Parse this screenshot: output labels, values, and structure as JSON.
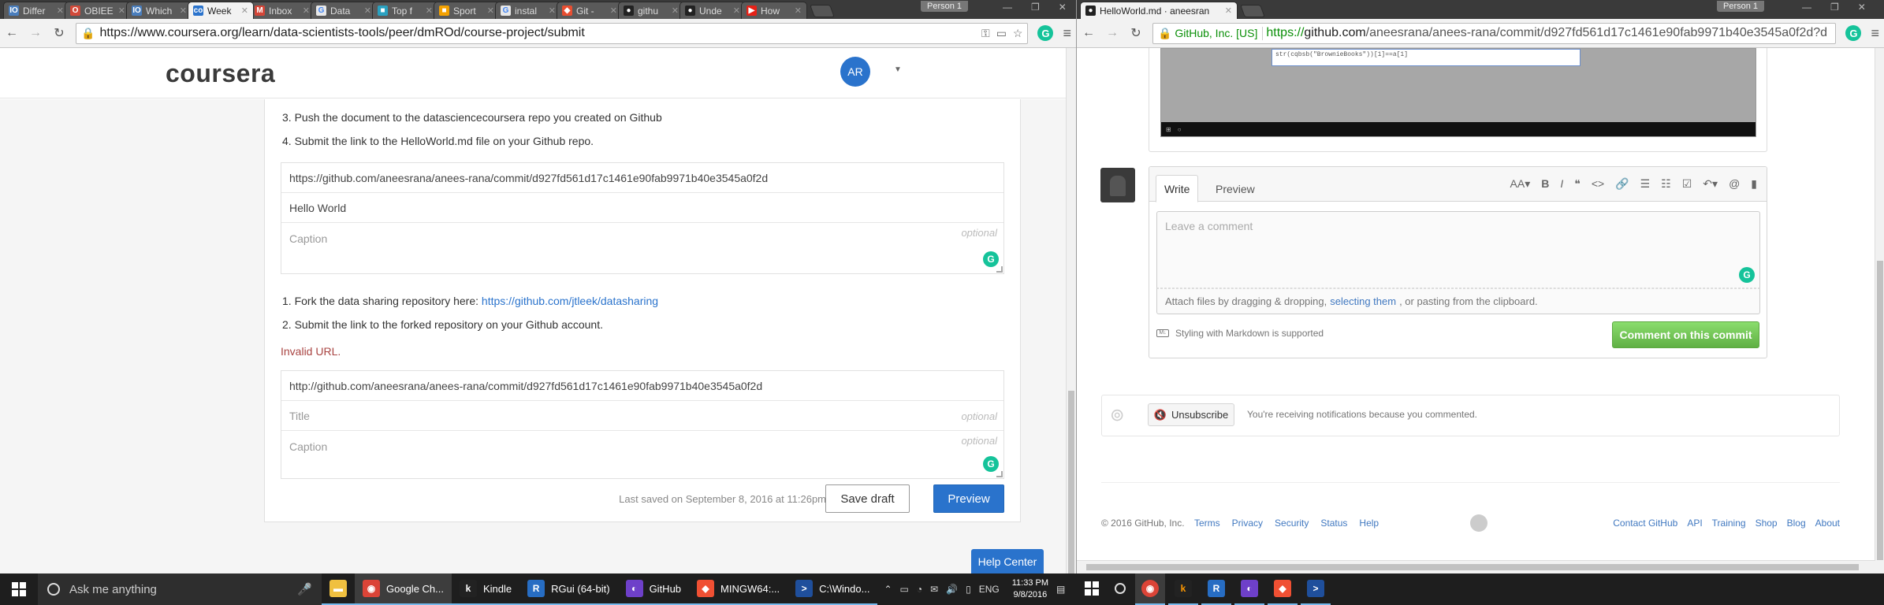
{
  "left_window": {
    "tabs": [
      {
        "label": "Differ",
        "fav": "IO",
        "color": "#4a7ebd"
      },
      {
        "label": "OBIEE",
        "fav": "O",
        "color": "#d24a3a"
      },
      {
        "label": "Which",
        "fav": "IO",
        "color": "#4a7ebd"
      },
      {
        "label": "Week",
        "fav": "co",
        "color": "#2a73cc",
        "active": true
      },
      {
        "label": "Inbox",
        "fav": "M",
        "color": "#d44638"
      },
      {
        "label": "Data",
        "fav": "G",
        "color": "#e8e8e8"
      },
      {
        "label": "Top f",
        "fav": "■",
        "color": "#2aa1c0"
      },
      {
        "label": "Sport",
        "fav": "■",
        "color": "#f4a100"
      },
      {
        "label": "instal",
        "fav": "G",
        "color": "#e8e8e8"
      },
      {
        "label": "Git -",
        "fav": "◆",
        "color": "#e84e31"
      },
      {
        "label": "githu",
        "fav": "●",
        "color": "#222"
      },
      {
        "label": "Unde",
        "fav": "●",
        "color": "#222"
      },
      {
        "label": "How",
        "fav": "▶",
        "color": "#e62117"
      }
    ],
    "persona": "Person 1",
    "url": "https://www.coursera.org/learn/data-scientists-tools/peer/dmROd/course-project/submit",
    "coursera": {
      "logo": "coursera",
      "avatar_initials": "AR",
      "instructions_a": [
        "3. Push the document to the datasciencecoursera repo you created on Github",
        "4. Submit the link to the HelloWorld.md file on your Github repo."
      ],
      "form1": {
        "url_value": "https://github.com/aneesrana/anees-rana/commit/d927fd561d17c1461e90fab9971b40e3545a0f2d",
        "title_value": "Hello World",
        "caption_placeholder": "Caption",
        "optional": "optional"
      },
      "instr_b1_text": "1. Fork the data sharing repository here: ",
      "instr_b1_link": "https://github.com/jtleek/datasharing",
      "instr_b2": "2. Submit the link to the forked repository on your Github account.",
      "error": "Invalid URL.",
      "form2": {
        "url_value": "http://github.com/aneesrana/anees-rana/commit/d927fd561d17c1461e90fab9971b40e3545a0f2d",
        "title_placeholder": "Title",
        "caption_placeholder": "Caption",
        "optional": "optional"
      },
      "last_saved": "Last saved on September 8, 2016 at 11:26pm",
      "save_draft": "Save draft",
      "preview": "Preview",
      "help_center": "Help Center"
    }
  },
  "right_window": {
    "tab_label": "HelloWorld.md · aneesran",
    "persona": "Person 1",
    "ev_badge": "GitHub, Inc. [US]",
    "url_scheme": "https://",
    "url_host": "github.com",
    "url_path": "/aneesrana/anees-rana/commit/d927fd561d17c1461e90fab9971b40e3545a0f2d?d",
    "screenshot_dialog_text": "str(cqbsb(\"BrownieBooks\"))[1]==a[1]",
    "comment": {
      "tab_write": "Write",
      "tab_preview": "Preview",
      "placeholder": "Leave a comment",
      "attach_pre": "Attach files by dragging & dropping,",
      "attach_link": "selecting them",
      "attach_post": ", or pasting from the clipboard.",
      "markdown_note": "Styling with Markdown is supported",
      "submit": "Comment on this commit"
    },
    "notifications": {
      "unsubscribe": "Unsubscribe",
      "reason": "You're receiving notifications because you commented."
    },
    "footer": {
      "copyright": "© 2016 GitHub, Inc.",
      "left_links": [
        "Terms",
        "Privacy",
        "Security",
        "Status",
        "Help"
      ],
      "right_links": [
        "Contact GitHub",
        "API",
        "Training",
        "Shop",
        "Blog",
        "About"
      ]
    }
  },
  "taskbar": {
    "search_placeholder": "Ask me anything",
    "items": [
      {
        "label": "",
        "icon": "file-explorer-icon",
        "color": "#f0c040",
        "glyph": "▬"
      },
      {
        "label": "Google Ch...",
        "icon": "chrome-icon",
        "color": "#db4437",
        "glyph": "◉",
        "active": true
      },
      {
        "label": "Kindle",
        "icon": "kindle-icon",
        "color": "#222",
        "glyph": "k"
      },
      {
        "label": "RGui (64-bit)",
        "icon": "r-icon",
        "color": "#276dc3",
        "glyph": "R"
      },
      {
        "label": "GitHub",
        "icon": "github-desktop-icon",
        "color": "#6e40c9",
        "glyph": "◐"
      },
      {
        "label": "MINGW64:...",
        "icon": "git-bash-icon",
        "color": "#f05033",
        "glyph": "◆"
      },
      {
        "label": "C:\\Windo...",
        "icon": "powershell-icon",
        "color": "#1f4f9c",
        "glyph": ">"
      }
    ],
    "language": "ENG",
    "time": "11:33 PM",
    "date": "9/8/2016"
  }
}
